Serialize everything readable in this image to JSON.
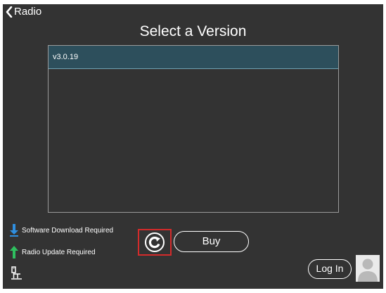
{
  "header": {
    "back_label": "Radio",
    "title": "Select a Version"
  },
  "versions": {
    "items": [
      {
        "label": "v3.0.19",
        "selected": true
      }
    ]
  },
  "legend": {
    "software_download": "Software Download Required",
    "radio_update": "Radio Update Required"
  },
  "actions": {
    "buy_label": "Buy",
    "login_label": "Log In"
  },
  "colors": {
    "background": "#333333",
    "selected_row": "#2d4f5c",
    "download_arrow": "#2f8fe0",
    "update_arrow": "#2fbf5f",
    "refresh_highlight": "#d42b2b"
  },
  "icons": {
    "back": "chevron-left-icon",
    "download": "download-arrow-icon",
    "update": "upload-arrow-icon",
    "refresh": "refresh-icon",
    "network": "network-icon",
    "avatar": "user-avatar-icon"
  }
}
